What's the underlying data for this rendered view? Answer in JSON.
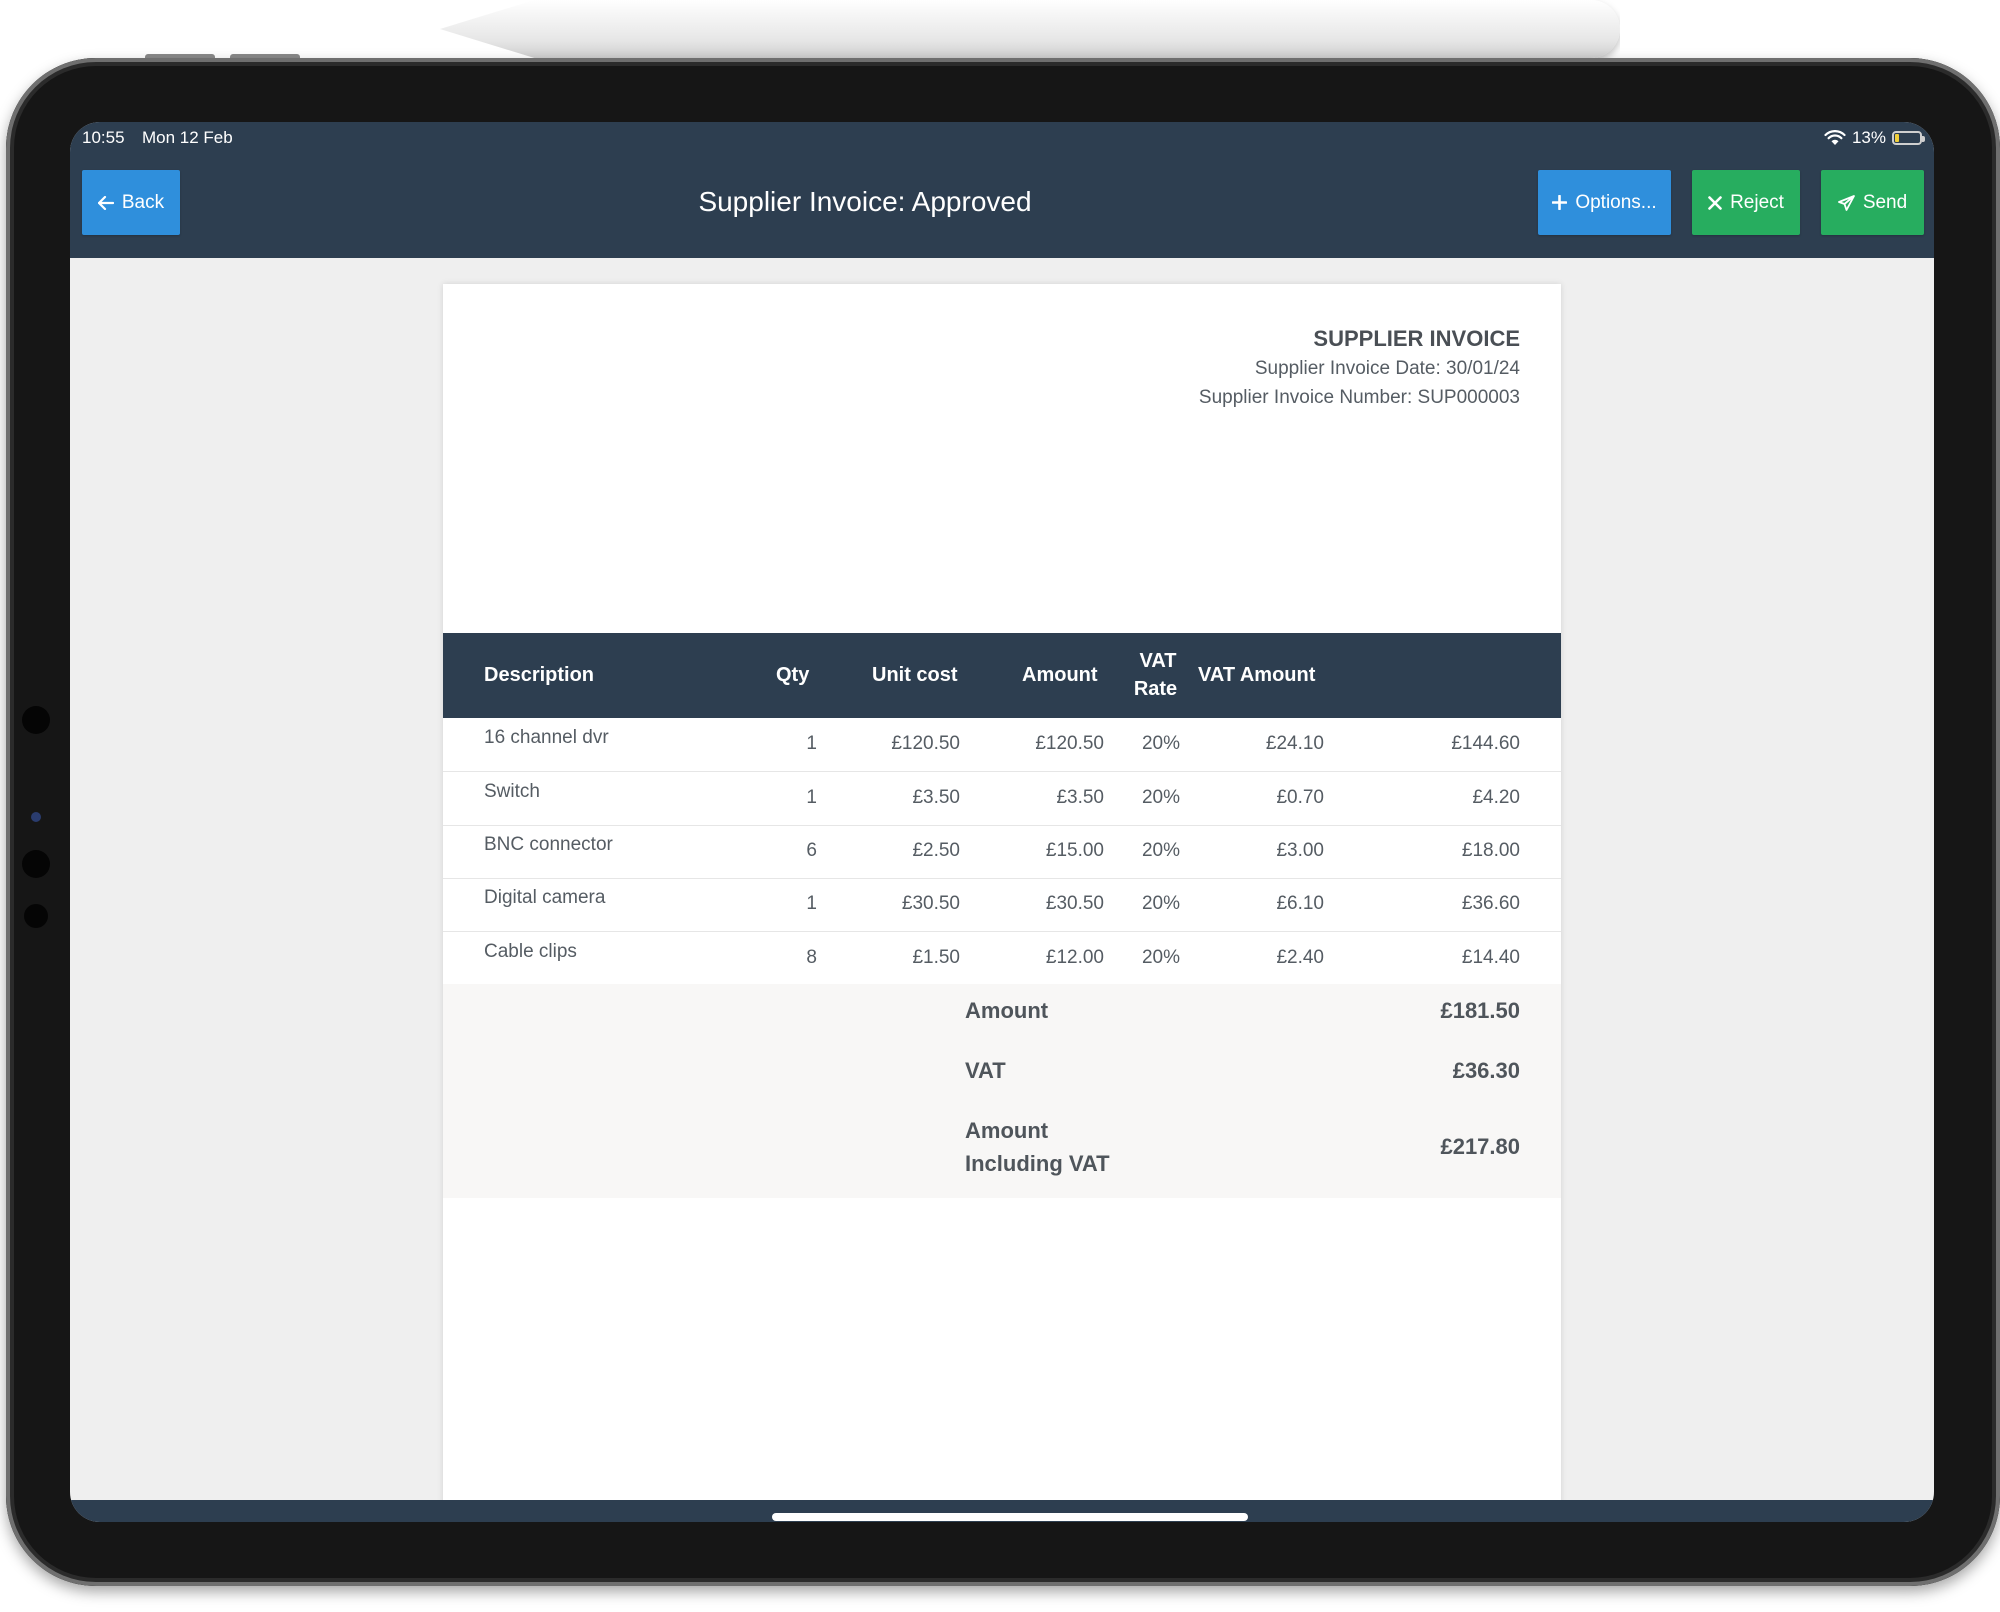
{
  "status_bar": {
    "time": "10:55",
    "date": "Mon 12 Feb",
    "battery": "13%"
  },
  "header": {
    "title": "Supplier Invoice: Approved",
    "back_label": "Back",
    "options_label": "Options...",
    "reject_label": "Reject",
    "send_label": "Send"
  },
  "invoice": {
    "heading": "SUPPLIER INVOICE",
    "date_line": "Supplier Invoice Date: 30/01/24",
    "number_line": "Supplier Invoice Number: SUP000003",
    "columns": {
      "description": "Description",
      "qty": "Qty",
      "unit_cost": "Unit cost",
      "amount": "Amount",
      "vat_rate_1": "VAT",
      "vat_rate_2": "Rate",
      "vat_amount": "VAT Amount"
    },
    "rows": [
      {
        "description": "16 channel dvr",
        "qty": "1",
        "unit_cost": "£120.50",
        "amount": "£120.50",
        "vat_rate": "20%",
        "vat_amount": "£24.10",
        "total": "£144.60"
      },
      {
        "description": "Switch",
        "qty": "1",
        "unit_cost": "£3.50",
        "amount": "£3.50",
        "vat_rate": "20%",
        "vat_amount": "£0.70",
        "total": "£4.20"
      },
      {
        "description": "BNC connector",
        "qty": "6",
        "unit_cost": "£2.50",
        "amount": "£15.00",
        "vat_rate": "20%",
        "vat_amount": "£3.00",
        "total": "£18.00"
      },
      {
        "description": "Digital camera",
        "qty": "1",
        "unit_cost": "£30.50",
        "amount": "£30.50",
        "vat_rate": "20%",
        "vat_amount": "£6.10",
        "total": "£36.60"
      },
      {
        "description": "Cable clips",
        "qty": "8",
        "unit_cost": "£1.50",
        "amount": "£12.00",
        "vat_rate": "20%",
        "vat_amount": "£2.40",
        "total": "£14.40"
      }
    ],
    "totals": {
      "amount_label": "Amount",
      "amount_value": "£181.50",
      "vat_label": "VAT",
      "vat_value": "£36.30",
      "incl_label_1": "Amount",
      "incl_label_2": "Including VAT",
      "incl_value": "£217.80"
    }
  },
  "colors": {
    "header_bg": "#2d3e50",
    "blue_button": "#2f8fdc",
    "green_button": "#27ad5f"
  }
}
